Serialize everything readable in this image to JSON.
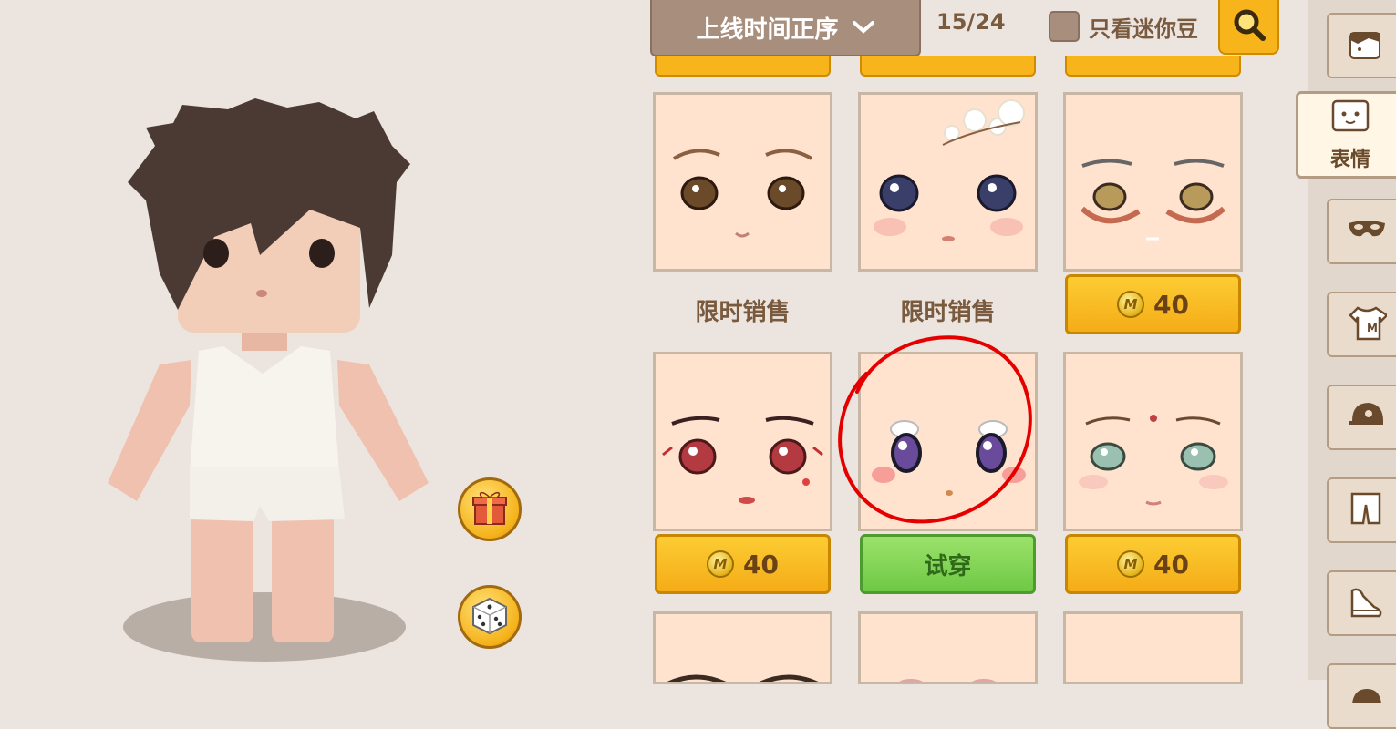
{
  "toolbar": {
    "sort_label": "上线时间正序",
    "page_count": "15/24",
    "mini_only_label": "只看迷你豆"
  },
  "grid": {
    "rows": [
      [
        {
          "status": "限时销售"
        },
        {
          "status": "限时销售"
        },
        {
          "price": "40"
        }
      ],
      [
        {
          "price": "40"
        },
        {
          "button": "试穿",
          "selected": true
        },
        {
          "price": "40"
        }
      ]
    ]
  },
  "tabs": {
    "expression_label": "表情",
    "icons": [
      "hair-icon",
      "face-icon",
      "mask-icon",
      "shirt-icon",
      "hat-icon",
      "pants-icon",
      "shoes-icon",
      "backpack-icon"
    ]
  },
  "colors": {
    "accent": "#f7b41b",
    "try_green": "#6fc845",
    "highlight_circle": "#e50000",
    "background": "#ece5df"
  }
}
